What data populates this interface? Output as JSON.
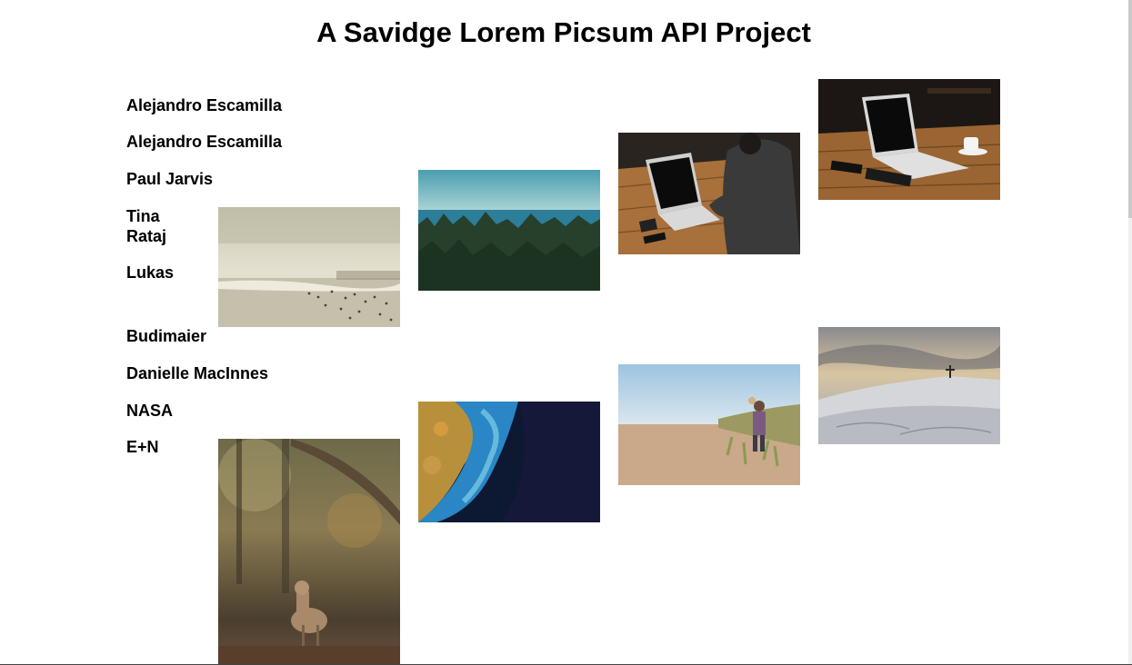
{
  "page": {
    "title": "A Savidge Lorem Picsum API Project"
  },
  "authors": [
    "Alejandro Escamilla",
    "Alejandro Escamilla",
    "Paul Jarvis",
    "Tina Rataj",
    "Lukas Budimaier",
    "Danielle MacInnes",
    "NASA",
    "E+N"
  ],
  "photos": [
    {
      "subject": "beach-crowd-photo"
    },
    {
      "subject": "forest-lake-photo"
    },
    {
      "subject": "laptop-desk-person-photo"
    },
    {
      "subject": "laptop-coffee-table-photo"
    },
    {
      "subject": "deer-forest-photo"
    },
    {
      "subject": "ocean-satellite-photo"
    },
    {
      "subject": "beach-walker-photo"
    },
    {
      "subject": "snowy-summit-photo"
    }
  ],
  "author_lukas_parts": [
    "Lukas",
    "Budimaier"
  ]
}
